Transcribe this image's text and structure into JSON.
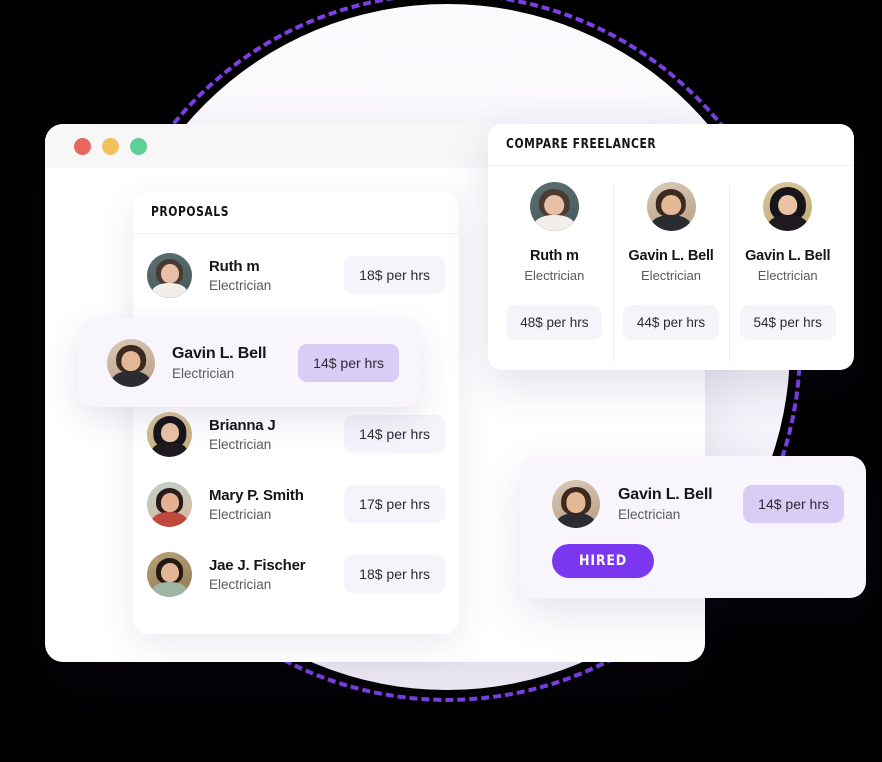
{
  "window": {
    "traffic_lights": [
      {
        "name": "close",
        "color": "#E8685F"
      },
      {
        "name": "minimize",
        "color": "#F1C25C"
      },
      {
        "name": "maximize",
        "color": "#5ECF96"
      }
    ]
  },
  "proposals": {
    "title": "PROPOSALS",
    "items": [
      {
        "name": "Ruth m",
        "role": "Electrician",
        "rate": "18$ per hrs",
        "avatar": "av-ruth"
      },
      {
        "name": "Brianna J",
        "role": "Electrician",
        "rate": "14$ per hrs",
        "avatar": "av-brianna"
      },
      {
        "name": "Mary P. Smith",
        "role": "Electrician",
        "rate": "17$ per hrs",
        "avatar": "av-mary"
      },
      {
        "name": "Jae J. Fischer",
        "role": "Electrician",
        "rate": "18$ per hrs",
        "avatar": "av-jae"
      }
    ]
  },
  "featured_row": {
    "name": "Gavin L. Bell",
    "role": "Electrician",
    "rate": "14$ per hrs",
    "avatar": "av-gavin"
  },
  "compare": {
    "title": "COMPARE FREELANCER",
    "columns": [
      {
        "name": "Ruth m",
        "role": "Electrician",
        "rate": "48$ per hrs",
        "avatar": "av-ruth"
      },
      {
        "name": "Gavin L. Bell",
        "role": "Electrician",
        "rate": "44$ per hrs",
        "avatar": "av-gavin"
      },
      {
        "name": "Gavin L. Bell",
        "role": "Electrician",
        "rate": "54$ per hrs",
        "avatar": "av-brianna"
      }
    ]
  },
  "hired": {
    "name": "Gavin L. Bell",
    "role": "Electrician",
    "rate": "14$ per hrs",
    "badge": "HIRED",
    "badge_color": "#7B37F0",
    "avatar": "av-gavin"
  },
  "theme": {
    "accent": "#7B37F0",
    "dashed_circle": "#7B3FE4",
    "circle_fill": "#F6F4FA",
    "pill_bg": "#F5F4FB",
    "pill_strong_bg": "#D9CCF5",
    "card_bg": "#FFFFFF",
    "highlight_bg": "#F8F6FC"
  }
}
